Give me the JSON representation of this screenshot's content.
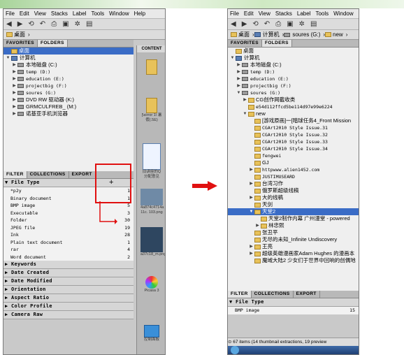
{
  "menu": [
    "File",
    "Edit",
    "View",
    "Stacks",
    "Label",
    "Tools",
    "Window",
    "Help"
  ],
  "left": {
    "path_label": "桌面",
    "panel_tabs": [
      "FAVORITES",
      "FOLDERS"
    ],
    "content_tab": "CONTENT",
    "tree": [
      {
        "label": "桌面",
        "selected": true,
        "arrow": "",
        "icon": "folder",
        "indent": 0
      },
      {
        "label": "计算机",
        "arrow": "▼",
        "icon": "pc",
        "indent": 0
      },
      {
        "label": "本地磁盘 (C:)",
        "arrow": "▶",
        "icon": "drive",
        "indent": 1
      },
      {
        "label": "temp (D:)",
        "arrow": "▶",
        "icon": "drive",
        "indent": 1,
        "mono": true
      },
      {
        "label": "education (E:)",
        "arrow": "▶",
        "icon": "drive",
        "indent": 1,
        "mono": true
      },
      {
        "label": "projectbig (F:)",
        "arrow": "▶",
        "icon": "drive",
        "indent": 1,
        "mono": true
      },
      {
        "label": "soures (G:)",
        "arrow": "▶",
        "icon": "drive",
        "indent": 1,
        "mono": true
      },
      {
        "label": "DVD RW 驱动器 (K:)",
        "arrow": "▶",
        "icon": "drive",
        "indent": 1
      },
      {
        "label": "GRMCULFREB_ (M:)",
        "arrow": "▶",
        "icon": "drive",
        "indent": 1
      },
      {
        "label": "诺基亚手机浏览器",
        "arrow": "▶",
        "icon": "drive",
        "indent": 1
      }
    ],
    "filter_tabs": [
      "FILTER",
      "COLLECTIONS",
      "EXPORT"
    ],
    "file_type_title": "File Type",
    "file_types": [
      {
        "name": "*p2y",
        "count": "1"
      },
      {
        "name": "Binary document",
        "count": "1"
      },
      {
        "name": "BMP image",
        "count": "5"
      },
      {
        "name": "Executable",
        "count": "3"
      },
      {
        "name": "Folder",
        "count": "30"
      },
      {
        "name": "JPEG file",
        "count": "19"
      },
      {
        "name": "Ink",
        "count": "28"
      },
      {
        "name": "Plain text document",
        "count": "1"
      },
      {
        "name": "rar",
        "count": "4"
      },
      {
        "name": "Word document",
        "count": "2"
      }
    ],
    "filter_sections": [
      "Keywords",
      "Date Created",
      "Date Modified",
      "Orientation",
      "Aspect Ratio",
      "Color Profile",
      "Camera Raw"
    ],
    "content_thumbs": [
      {
        "caption": ""
      },
      {
        "caption": "[\\sirror 1\\ 暑假(.5E)"
      },
      {
        "caption": "旧讲座的Q 分配意见"
      },
      {
        "caption": "4a874c4714a 11c. 103.png"
      },
      {
        "caption": "a37c18_m.png"
      },
      {
        "caption": "Picasa 3"
      },
      {
        "caption": "控制面板"
      }
    ]
  },
  "right": {
    "path": [
      "桌面",
      "计算机",
      "soures (G:)",
      "new"
    ],
    "panel_tabs": [
      "FAVORITES",
      "FOLDERS"
    ],
    "tree": [
      {
        "label": "桌面",
        "arrow": "",
        "icon": "folder",
        "indent": 0
      },
      {
        "label": "计算机",
        "arrow": "▼",
        "icon": "pc",
        "indent": 0
      },
      {
        "label": "本地磁盘 (C:)",
        "arrow": "▶",
        "icon": "drive",
        "indent": 1
      },
      {
        "label": "temp (D:)",
        "arrow": "▶",
        "icon": "drive",
        "indent": 1,
        "mono": true
      },
      {
        "label": "education (E:)",
        "arrow": "▶",
        "icon": "drive",
        "indent": 1,
        "mono": true
      },
      {
        "label": "projectbig (F:)",
        "arrow": "▶",
        "icon": "drive",
        "indent": 1,
        "mono": true
      },
      {
        "label": "soures (G:)",
        "arrow": "▼",
        "icon": "drive",
        "indent": 1,
        "mono": true
      },
      {
        "label": "CG创作网截收类",
        "arrow": "▶",
        "icon": "folder",
        "indent": 2
      },
      {
        "label": "e54d112ffcd5be114d97e99e6224",
        "arrow": "",
        "icon": "folder",
        "indent": 2,
        "mono": true
      },
      {
        "label": "new",
        "arrow": "▼",
        "icon": "folder",
        "indent": 2
      },
      {
        "label": "[游戏原画]一[暗球任务4_Front Mission",
        "arrow": "",
        "icon": "folder",
        "indent": 3
      },
      {
        "label": "CGArt2010 Style Issue.31",
        "arrow": "",
        "icon": "folder",
        "indent": 3,
        "mono": true
      },
      {
        "label": "CGArt2010 Style Issue.32",
        "arrow": "",
        "icon": "folder",
        "indent": 3,
        "mono": true
      },
      {
        "label": "CGArt2010 Style Issue.33",
        "arrow": "",
        "icon": "folder",
        "indent": 3,
        "mono": true
      },
      {
        "label": "CGArt2010 Style Issue.34",
        "arrow": "",
        "icon": "folder",
        "indent": 3,
        "mono": true
      },
      {
        "label": "fengwei",
        "arrow": "",
        "icon": "folder",
        "indent": 3,
        "mono": true
      },
      {
        "label": "GJ",
        "arrow": "",
        "icon": "folder",
        "indent": 3
      },
      {
        "label": "httpwww.alien1452.com",
        "arrow": "▶",
        "icon": "folder",
        "indent": 3,
        "mono": true
      },
      {
        "label": "JUSTIMUSEARD",
        "arrow": "",
        "icon": "folder",
        "indent": 3,
        "mono": true
      },
      {
        "label": "台湾习作",
        "arrow": "▶",
        "icon": "folder",
        "indent": 3
      },
      {
        "label": "俄罗斯超级线稿",
        "arrow": "",
        "icon": "folder",
        "indent": 3
      },
      {
        "label": "大的线稿",
        "arrow": "▶",
        "icon": "folder",
        "indent": 3
      },
      {
        "label": "天剑",
        "arrow": "",
        "icon": "folder",
        "indent": 3
      },
      {
        "label": "天堂2",
        "arrow": "▼",
        "icon": "folder",
        "indent": 3,
        "selected": true
      },
      {
        "label": "天堂2制作内幕 广州漫堂 - powered",
        "arrow": "",
        "icon": "folder",
        "indent": 4
      },
      {
        "label": "林忠熙",
        "arrow": "▶",
        "icon": "folder",
        "indent": 4
      },
      {
        "label": "张丑平",
        "arrow": "",
        "icon": "folder",
        "indent": 3
      },
      {
        "label": "无尽的未知_Infinite Undiscovery",
        "arrow": "",
        "icon": "folder",
        "indent": 3
      },
      {
        "label": "王亮",
        "arrow": "▶",
        "icon": "folder",
        "indent": 3
      },
      {
        "label": "超级英雄漫画家Adam Hughes 的漫画本",
        "arrow": "▶",
        "icon": "folder",
        "indent": 3
      },
      {
        "label": "魔域大陆2 少女们于世界中回响的创偶地",
        "arrow": "",
        "icon": "folder",
        "indent": 3
      }
    ],
    "filter_tabs": [
      "FILTER",
      "COLLECTIONS",
      "EXPORT"
    ],
    "file_type_title": "File Type",
    "file_types": [
      {
        "name": "BMP image",
        "count": "15"
      }
    ],
    "status": "67 items (14 thumbnail extractions, 19 preview"
  },
  "colors": {
    "accent_red": "#e01010",
    "selection": "#3a6cc6"
  }
}
